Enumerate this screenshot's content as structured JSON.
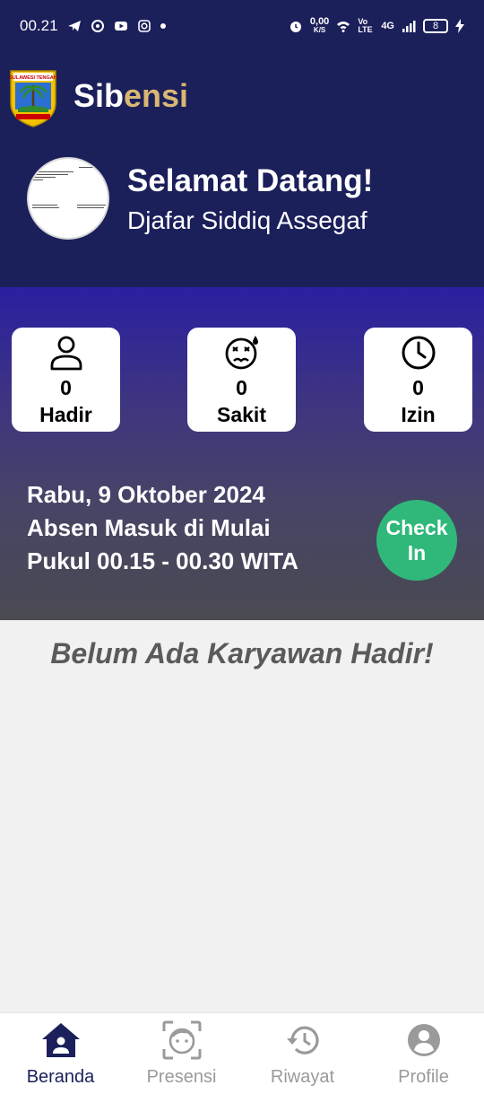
{
  "status_bar": {
    "time": "00.21",
    "net_speed": "0,00",
    "net_unit": "K/S",
    "volte": "Vo LTE",
    "network": "4G",
    "battery": "8"
  },
  "header": {
    "title_prefix": "Sib",
    "title_suffix": "ensi",
    "welcome": "Selamat Datang!",
    "user_name": "Djafar Siddiq Assegaf"
  },
  "stats": [
    {
      "count": "0",
      "label": "Hadir",
      "icon": "person-icon"
    },
    {
      "count": "0",
      "label": "Sakit",
      "icon": "sick-face-icon"
    },
    {
      "count": "0",
      "label": "Izin",
      "icon": "clock-icon"
    }
  ],
  "schedule": {
    "date": "Rabu, 9 Oktober 2024",
    "line2": "Absen Masuk di Mulai",
    "line3": "Pukul 00.15 - 00.30 WITA",
    "checkin_line1": "Check",
    "checkin_line2": "In"
  },
  "empty_message": "Belum Ada Karyawan Hadir!",
  "nav": [
    {
      "label": "Beranda",
      "icon": "home-icon",
      "active": true
    },
    {
      "label": "Presensi",
      "icon": "face-scan-icon",
      "active": false
    },
    {
      "label": "Riwayat",
      "icon": "history-icon",
      "active": false
    },
    {
      "label": "Profile",
      "icon": "account-icon",
      "active": false
    }
  ],
  "colors": {
    "primary": "#1b1f5a",
    "accent": "#d9b774",
    "checkin": "#2fb87a",
    "inactive_nav": "#9a9a9a"
  }
}
